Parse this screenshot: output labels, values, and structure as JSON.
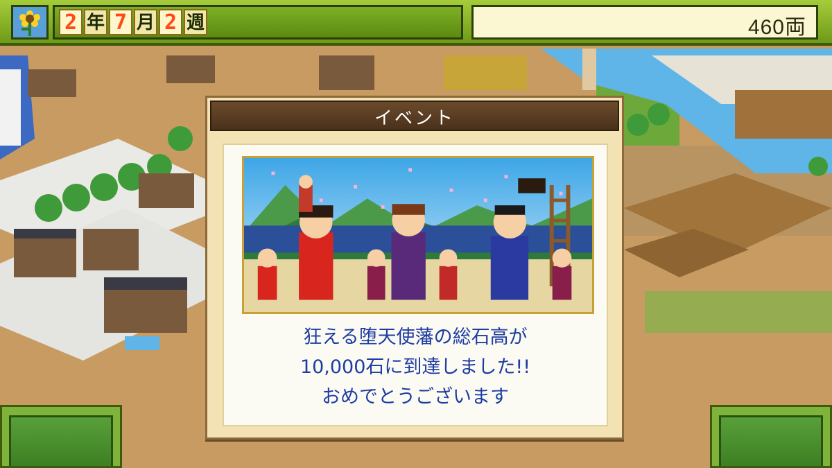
{
  "hud": {
    "season_icon": "sunflower-icon",
    "date": {
      "year": "2",
      "year_unit": "年",
      "month": "7",
      "month_unit": "月",
      "week": "2",
      "week_unit": "週"
    },
    "money": "460両"
  },
  "dialog": {
    "title": "イベント",
    "message_lines": [
      "狂える堕天使藩の総石高が",
      "10,000石に到達しました!!",
      "おめでとうございます"
    ]
  },
  "colors": {
    "hud_green": "#8ab82c",
    "message_blue": "#1e3ca2",
    "header_brown": "#5a3d22",
    "frame_gold": "#c8a038"
  }
}
